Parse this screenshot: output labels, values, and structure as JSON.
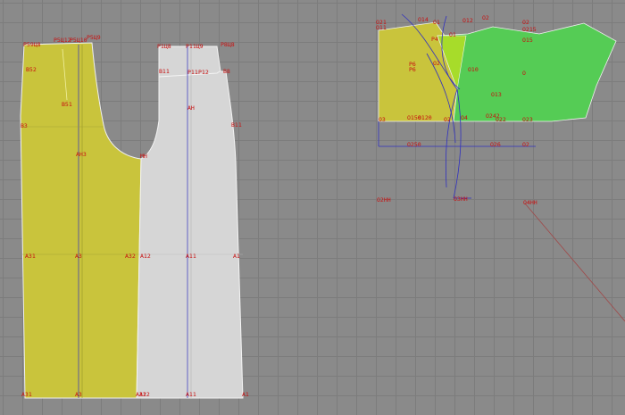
{
  "colors": {
    "grid_bg": "#8a8a8a",
    "grid_line": "#7c7c7c",
    "front_piece": "#c9c43c",
    "back_piece": "#d4d4d4",
    "sleeve_left": "#c9c43c",
    "sleeve_right": "#55cc55",
    "overlap": "#a7dc2a",
    "label": "#c81010",
    "construction_line": "#3030c0"
  },
  "labels": {
    "front_top_left": "P59Ц8",
    "front_top_mid1": "P5Ц12",
    "front_top_mid2": "P5Ц10",
    "front_top_right": "P5Ц9",
    "front_b52": "B52",
    "front_b51": "B51",
    "front_b3": "B3",
    "front_ah3": "AH3",
    "front_a31": "A31",
    "front_a3": "A3",
    "front_a32": "A32",
    "front_bottom_left": "A31",
    "front_bottom_mid": "A3",
    "front_bottom_right": "A32",
    "front_mh": "MH",
    "back_top_left": "P1Ц8",
    "back_top_mid": "P11Ц9",
    "back_top_right": "P8Ц8",
    "back_p11": "P11",
    "back_p12": "P12",
    "back_b11": "B11",
    "back_b8": "B8",
    "back_b11_lower": "B11",
    "back_ah": "AH",
    "back_a12": "A12",
    "back_a11": "A11",
    "back_a1": "A1",
    "back_bottom_left": "A12",
    "back_bottom_mid": "A11",
    "back_bottom_right": "A1",
    "sleeve_o21": "O21",
    "sleeve_o11": "O11",
    "sleeve_o1": "O1",
    "sleeve_o14": "O14",
    "sleeve_o12": "O12",
    "sleeve_o2": "O2",
    "sleeve_o215": "O215",
    "sleeve_o2t": "O2",
    "sleeve_o1_mid": "O1",
    "sleeve_o15": "O15",
    "sleeve_p4": "P4",
    "sleeve_p6": "P6",
    "sleeve_o10": "O10",
    "sleeve_o": "O",
    "sleeve_o13": "O13",
    "sleeve_o3": "O3",
    "sleeve_o150": "O150",
    "sleeve_o120": "O120",
    "sleeve_o2b": "O2",
    "sleeve_o4": "O4",
    "sleeve_o242": "O242",
    "sleeve_o22": "O22",
    "sleeve_o23": "O23",
    "sleeve_o2b2": "O2",
    "sleeve_p6b": "P6",
    "sleeve_o250": "O250",
    "sleeve_o26": "O26",
    "sleeve_o2hh": "O2HH",
    "sleeve_o3hh": "O3HH",
    "sleeve_o4hh": "O4HH",
    "sleeve_o2c": "O2"
  }
}
